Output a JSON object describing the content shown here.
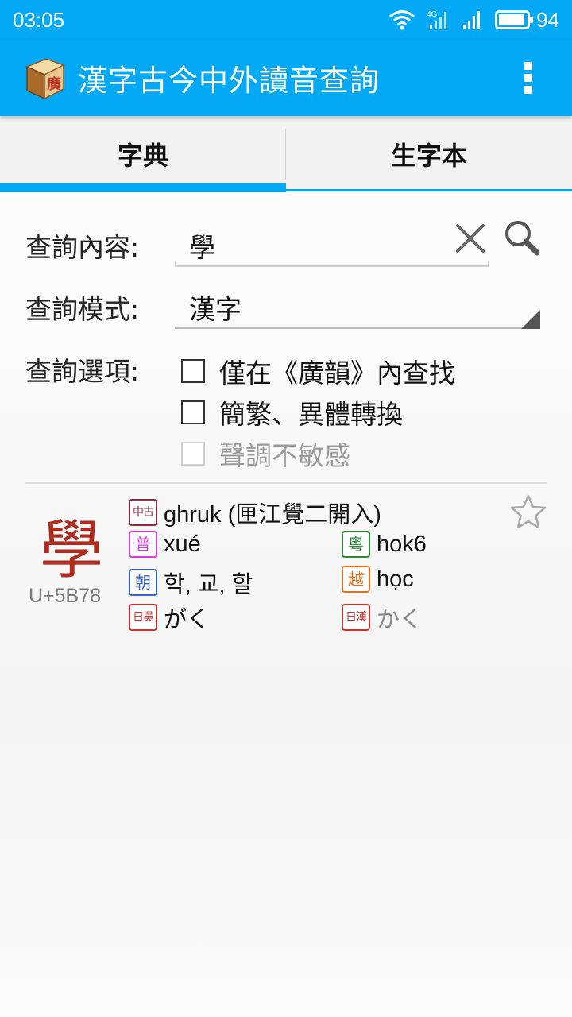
{
  "status": {
    "time": "03:05",
    "network": "4G",
    "battery": "94"
  },
  "app": {
    "title": "漢字古今中外讀音查詢",
    "logo_char": "廣"
  },
  "tabs": [
    {
      "label": "字典",
      "selected": true
    },
    {
      "label": "生字本",
      "selected": false
    }
  ],
  "form": {
    "query_label": "查詢內容:",
    "query_value": "學",
    "mode_label": "查詢模式:",
    "mode_value": "漢字",
    "options_label": "查詢選項:",
    "options": [
      {
        "label": "僅在《廣韻》內查找",
        "checked": false,
        "enabled": true
      },
      {
        "label": "簡繁、異體轉換",
        "checked": false,
        "enabled": true
      },
      {
        "label": "聲調不敏感",
        "checked": false,
        "enabled": false
      }
    ]
  },
  "result": {
    "character": "學",
    "codepoint": "U+5B78",
    "readings": [
      {
        "badge": "中古",
        "text": "ghruk (匣江覺二開入)",
        "color": "#8a2a3a"
      },
      {
        "badge": "普",
        "text": "xué",
        "color": "#d63bd6"
      },
      {
        "badge": "粵",
        "text": "hok6",
        "color": "#2e8b3a"
      },
      {
        "badge": "朝",
        "text": "학, 교, 할",
        "color": "#3a5fcf"
      },
      {
        "badge": "越",
        "text": "học",
        "color": "#e07020"
      },
      {
        "badge": "日吳",
        "text": "がく",
        "color": "#d03030"
      },
      {
        "badge": "日漢",
        "text": "かく",
        "color": "#d03030"
      }
    ],
    "starred": false
  },
  "colors": {
    "accent": "#03a9f4",
    "character": "#b02a1e"
  }
}
